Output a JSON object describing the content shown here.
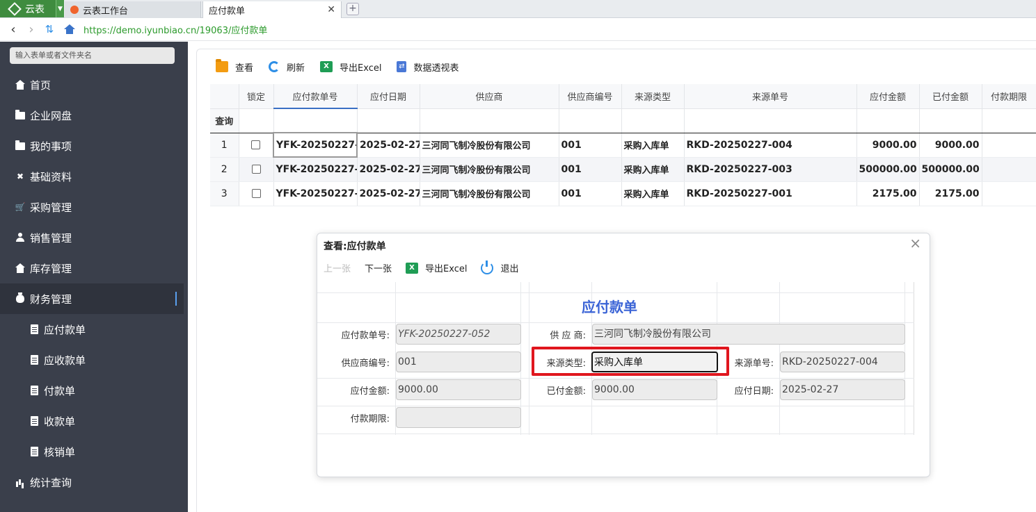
{
  "browser": {
    "app_name": "云表",
    "tabs": [
      {
        "label": "云表工作台"
      },
      {
        "label": "应付款单"
      }
    ],
    "url": "https://demo.iyunbiao.cn/19063/应付款单"
  },
  "sidebar": {
    "search_placeholder": "输入表单或者文件夹名",
    "items": [
      {
        "label": "首页",
        "icon": "home-icon"
      },
      {
        "label": "企业网盘",
        "icon": "folder-icon"
      },
      {
        "label": "我的事项",
        "icon": "folder-icon"
      },
      {
        "label": "基础资料",
        "icon": "tools-icon"
      },
      {
        "label": "采购管理",
        "icon": "cart-icon"
      },
      {
        "label": "销售管理",
        "icon": "user-icon"
      },
      {
        "label": "库存管理",
        "icon": "home-icon"
      },
      {
        "label": "财务管理",
        "icon": "money-bag-icon",
        "active": true
      },
      {
        "label": "应付款单",
        "icon": "document-icon"
      },
      {
        "label": "应收款单",
        "icon": "document-icon"
      },
      {
        "label": "付款单",
        "icon": "document-icon"
      },
      {
        "label": "收款单",
        "icon": "document-icon"
      },
      {
        "label": "核销单",
        "icon": "document-icon"
      },
      {
        "label": "统计查询",
        "icon": "bar-chart-icon"
      }
    ]
  },
  "toolbar": {
    "view": "查看",
    "refresh": "刷新",
    "export": "导出Excel",
    "pivot": "数据透视表"
  },
  "grid": {
    "query_label": "查询",
    "columns": [
      "锁定",
      "应付款单号",
      "应付日期",
      "供应商",
      "供应商编号",
      "来源类型",
      "来源单号",
      "应付金额",
      "已付金额",
      "付款期限"
    ],
    "rows": [
      {
        "n": "1",
        "no": "YFK-20250227-0",
        "date": "2025-02-27",
        "supplier": "三河同飞制冷股份有限公司",
        "code": "001",
        "src_type": "采购入库单",
        "src_no": "RKD-20250227-004",
        "payable": "9000.00",
        "paid": "9000.00",
        "term": ""
      },
      {
        "n": "2",
        "no": "YFK-20250227-0",
        "date": "2025-02-27",
        "supplier": "三河同飞制冷股份有限公司",
        "code": "001",
        "src_type": "采购入库单",
        "src_no": "RKD-20250227-003",
        "payable": "500000.00",
        "paid": "500000.00",
        "term": ""
      },
      {
        "n": "3",
        "no": "YFK-20250227-0",
        "date": "2025-02-27",
        "supplier": "三河同飞制冷股份有限公司",
        "code": "001",
        "src_type": "采购入库单",
        "src_no": "RKD-20250227-001",
        "payable": "2175.00",
        "paid": "2175.00",
        "term": ""
      }
    ]
  },
  "dialog": {
    "title": "查看:应付款单",
    "prev": "上一张",
    "next": "下一张",
    "export": "导出Excel",
    "exit": "退出",
    "form_title": "应付款单",
    "fields": {
      "no_label": "应付款单号:",
      "no_value": "YFK-20250227-052",
      "supplier_label": "供 应 商:",
      "supplier_value": "三河同飞制冷股份有限公司",
      "code_label": "供应商编号:",
      "code_value": "001",
      "src_type_label": "来源类型:",
      "src_type_value": "采购入库单",
      "src_no_label": "来源单号:",
      "src_no_value": "RKD-20250227-004",
      "payable_label": "应付金额:",
      "payable_value": "9000.00",
      "paid_label": "已付金额:",
      "paid_value": "9000.00",
      "date_label": "应付日期:",
      "date_value": "2025-02-27",
      "term_label": "付款期限:",
      "term_value": ""
    }
  },
  "colors": {
    "sidebar_bg": "#3a3f4b",
    "accent": "#3a63d6",
    "highlight": "#e0161e",
    "app_green": "#3f8c3f"
  }
}
